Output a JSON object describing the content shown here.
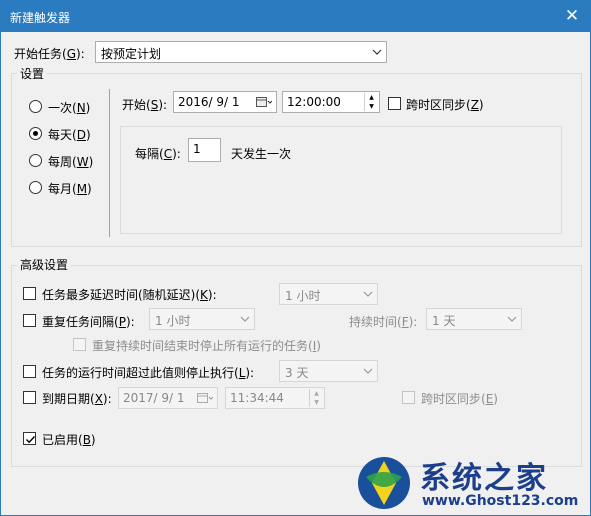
{
  "window": {
    "title": "新建触发器",
    "close": "✕"
  },
  "start_task": {
    "label": "开始任务(",
    "key": "G",
    "suffix": "):",
    "value": "按预定计划"
  },
  "settings": {
    "title": "设置",
    "radios": [
      {
        "label": "一次(",
        "key": "N",
        "suffix": ")",
        "checked": false
      },
      {
        "label": "每天(",
        "key": "D",
        "suffix": ")",
        "checked": true
      },
      {
        "label": "每周(",
        "key": "W",
        "suffix": ")",
        "checked": false
      },
      {
        "label": "每月(",
        "key": "M",
        "suffix": ")",
        "checked": false
      }
    ],
    "start": {
      "label": "开始(",
      "key": "S",
      "suffix": "):",
      "date": "2016/  9/  1",
      "time": "12:00:00"
    },
    "sync_tz": {
      "label": "跨时区同步(",
      "key": "Z",
      "suffix": ")"
    },
    "every": {
      "label": "每隔(",
      "key": "C",
      "suffix": "):",
      "value": "1",
      "unit": "天发生一次"
    }
  },
  "advanced": {
    "title": "高级设置",
    "delay": {
      "label": "任务最多延迟时间(随机延迟)(",
      "key": "K",
      "suffix": "):",
      "value": "1 小时"
    },
    "repeat": {
      "label": "重复任务间隔(",
      "key": "P",
      "suffix": "):",
      "value": "1 小时",
      "duration_label": "持续时间(",
      "duration_key": "F",
      "duration_suffix": "):",
      "duration_value": "1 天",
      "stop_label": "重复持续时间结束时停止所有运行的任务(",
      "stop_key": "I",
      "stop_suffix": ")"
    },
    "stop_if": {
      "label": "任务的运行时间超过此值则停止执行(",
      "key": "L",
      "suffix": "):",
      "value": "3 天"
    },
    "expire": {
      "label": "到期日期(",
      "key": "X",
      "suffix": "):",
      "date": "2017/  9/  1",
      "time": "11:34:44",
      "sync_label": "跨时区同步(",
      "sync_key": "E",
      "sync_suffix": ")"
    },
    "enabled": {
      "label": "已启用(",
      "key": "B",
      "suffix": ")",
      "checked": true
    }
  },
  "watermark": {
    "brand": "系统之家",
    "url": "www.Ghost123.com"
  }
}
